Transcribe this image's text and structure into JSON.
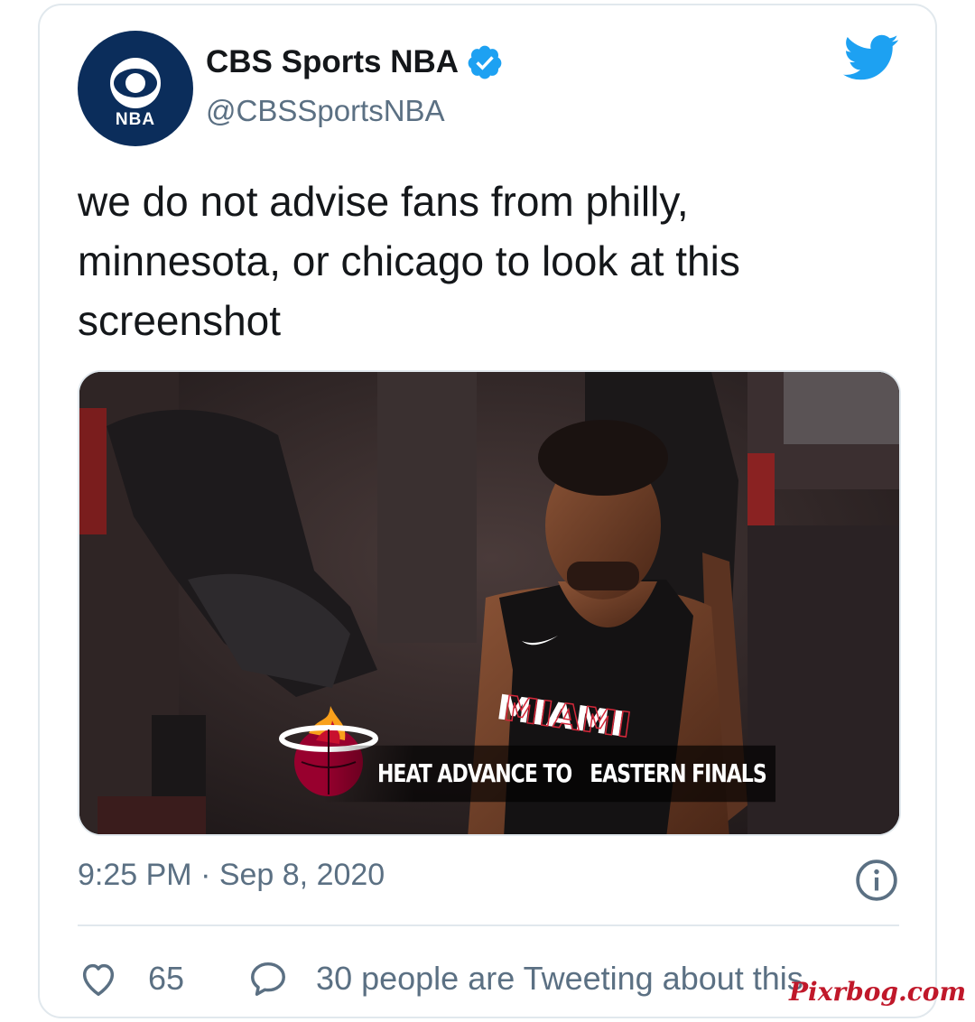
{
  "account": {
    "display_name": "CBS Sports NBA",
    "handle": "@CBSSportsNBA",
    "verified": true,
    "avatar_text": "NBA"
  },
  "tweet": {
    "text": "we do not advise fans from philly, minnesota, or chicago to look at this screenshot",
    "timestamp": "9:25 PM · Sep 8, 2020"
  },
  "media": {
    "overlay_text": "HEAT ADVANCE TO   EASTERN FINALS",
    "jersey_text": "MIAMI"
  },
  "actions": {
    "like_count": "65",
    "reply_text": "30 people are Tweeting about this"
  },
  "watermark": "Pixrbog.com",
  "colors": {
    "twitter_blue": "#1da1f2",
    "text_primary": "#14171a",
    "text_secondary": "#5b7083",
    "border": "#e1e8ed",
    "avatar_bg": "#0b2d5b",
    "watermark": "#c0182a"
  },
  "icons": {
    "brand": "twitter-bird-icon",
    "verified": "verified-badge-icon",
    "info": "info-icon",
    "like": "heart-icon",
    "reply": "speech-bubble-icon"
  }
}
